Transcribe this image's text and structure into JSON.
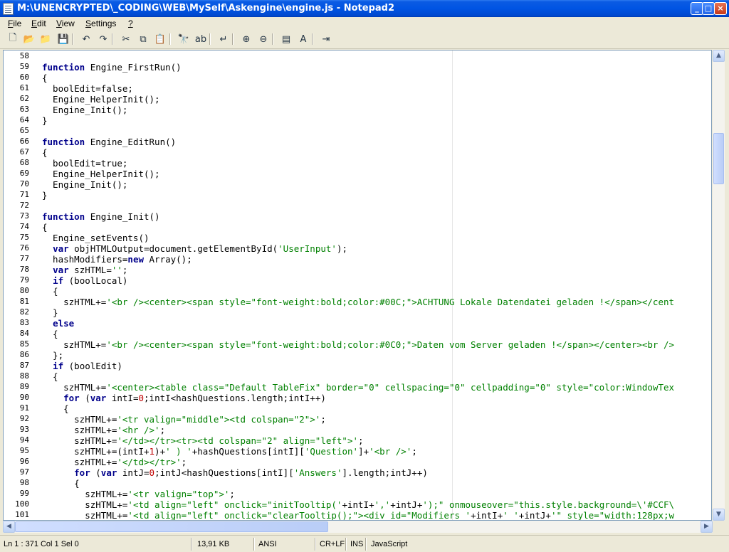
{
  "window": {
    "title": "M:\\UNENCRYPTED\\_CODING\\WEB\\MySelf\\Askengine\\engine.js - Notepad2",
    "minimize_symbol": "_",
    "maximize_symbol": "□",
    "close_symbol": "×"
  },
  "menu": {
    "items": [
      {
        "ul": "F",
        "rest": "ile"
      },
      {
        "ul": "E",
        "rest": "dit"
      },
      {
        "ul": "V",
        "rest": "iew"
      },
      {
        "ul": "S",
        "rest": "ettings"
      },
      {
        "ul": "?",
        "rest": ""
      }
    ]
  },
  "toolbar": {
    "buttons": [
      {
        "name": "new-file-icon",
        "glyph": "🗋"
      },
      {
        "name": "open-file-icon",
        "glyph": "📂"
      },
      {
        "name": "browse-icon",
        "glyph": "📁"
      },
      {
        "name": "save-icon",
        "glyph": "💾"
      },
      {
        "name": "undo-icon",
        "glyph": "↶"
      },
      {
        "name": "redo-icon",
        "glyph": "↷"
      },
      {
        "name": "cut-icon",
        "glyph": "✂"
      },
      {
        "name": "copy-icon",
        "glyph": "⧉"
      },
      {
        "name": "paste-icon",
        "glyph": "📋"
      },
      {
        "name": "find-icon",
        "glyph": "🔭"
      },
      {
        "name": "replace-icon",
        "glyph": "ab"
      },
      {
        "name": "word-wrap-icon",
        "glyph": "↵"
      },
      {
        "name": "zoom-in-icon",
        "glyph": "⊕"
      },
      {
        "name": "zoom-out-icon",
        "glyph": "⊖"
      },
      {
        "name": "scheme-icon",
        "glyph": "▤"
      },
      {
        "name": "customize-scheme-icon",
        "glyph": "A"
      },
      {
        "name": "exit-icon",
        "glyph": "⇥"
      }
    ]
  },
  "editor": {
    "lines": [
      {
        "n": "58",
        "t": ""
      },
      {
        "n": "59",
        "t": "function Engine_FirstRun()"
      },
      {
        "n": "60",
        "t": "{"
      },
      {
        "n": "61",
        "t": "  boolEdit=false;"
      },
      {
        "n": "62",
        "t": "  Engine_HelperInit();"
      },
      {
        "n": "63",
        "t": "  Engine_Init();"
      },
      {
        "n": "64",
        "t": "}"
      },
      {
        "n": "65",
        "t": ""
      },
      {
        "n": "66",
        "t": "function Engine_EditRun()"
      },
      {
        "n": "67",
        "t": "{"
      },
      {
        "n": "68",
        "t": "  boolEdit=true;"
      },
      {
        "n": "69",
        "t": "  Engine_HelperInit();"
      },
      {
        "n": "70",
        "t": "  Engine_Init();"
      },
      {
        "n": "71",
        "t": "}"
      },
      {
        "n": "72",
        "t": ""
      },
      {
        "n": "73",
        "t": "function Engine_Init()"
      },
      {
        "n": "74",
        "t": "{"
      },
      {
        "n": "75",
        "t": "  Engine_setEvents()"
      },
      {
        "n": "76",
        "t": "  var objHTMLOutput=document.getElementById('UserInput');"
      },
      {
        "n": "77",
        "t": "  hashModifiers=new Array();"
      },
      {
        "n": "78",
        "t": "  var szHTML='';"
      },
      {
        "n": "79",
        "t": "  if (boolLocal)"
      },
      {
        "n": "80",
        "t": "  {"
      },
      {
        "n": "81",
        "t": "    szHTML+='<br /><center><span style=\"font-weight:bold;color:#00C;\">ACHTUNG Lokale Datendatei geladen !</span></cent"
      },
      {
        "n": "82",
        "t": "  }"
      },
      {
        "n": "83",
        "t": "  else"
      },
      {
        "n": "84",
        "t": "  {"
      },
      {
        "n": "85",
        "t": "    szHTML+='<br /><center><span style=\"font-weight:bold;color:#0C0;\">Daten vom Server geladen !</span></center><br />"
      },
      {
        "n": "86",
        "t": "  };"
      },
      {
        "n": "87",
        "t": "  if (boolEdit)"
      },
      {
        "n": "88",
        "t": "  {"
      },
      {
        "n": "89",
        "t": "    szHTML+='<center><table class=\"Default TableFix\" border=\"0\" cellspacing=\"0\" cellpadding=\"0\" style=\"color:WindowTex"
      },
      {
        "n": "90",
        "t": "    for (var intI=0;intI<hashQuestions.length;intI++)"
      },
      {
        "n": "91",
        "t": "    {"
      },
      {
        "n": "92",
        "t": "      szHTML+='<tr valign=\"middle\"><td colspan=\"2\">';"
      },
      {
        "n": "93",
        "t": "      szHTML+='<hr />';"
      },
      {
        "n": "94",
        "t": "      szHTML+='</td></tr><tr><td colspan=\"2\" align=\"left\">';"
      },
      {
        "n": "95",
        "t": "      szHTML+=(intI+1)+' ) '+hashQuestions[intI]['Question']+'<br />';"
      },
      {
        "n": "96",
        "t": "      szHTML+='</td></tr>';"
      },
      {
        "n": "97",
        "t": "      for (var intJ=0;intJ<hashQuestions[intI]['Answers'].length;intJ++)"
      },
      {
        "n": "98",
        "t": "      {"
      },
      {
        "n": "99",
        "t": "        szHTML+='<tr valign=\"top\">';"
      },
      {
        "n": "100",
        "t": "        szHTML+='<td align=\"left\" onclick=\"initTooltip('+intI+','+intJ+');\" onmouseover=\"this.style.background=\\'#CCF\\"
      },
      {
        "n": "101",
        "t": "        szHTML+='<td align=\"left\" onclick=\"clearTooltip();\"><div id=\"Modifiers_'+intI+'_'+intJ+'\" style=\"width:128px;w"
      }
    ]
  },
  "statusbar": {
    "position": "Ln 1 : 371   Col 1   Sel 0",
    "size": "13,91 KB",
    "encoding": "ANSI",
    "line_endings": "CR+LF",
    "insert_mode": "INS",
    "scheme": "JavaScript"
  },
  "scroll": {
    "v_fraction": 0.18,
    "h_fraction": 0.0
  }
}
